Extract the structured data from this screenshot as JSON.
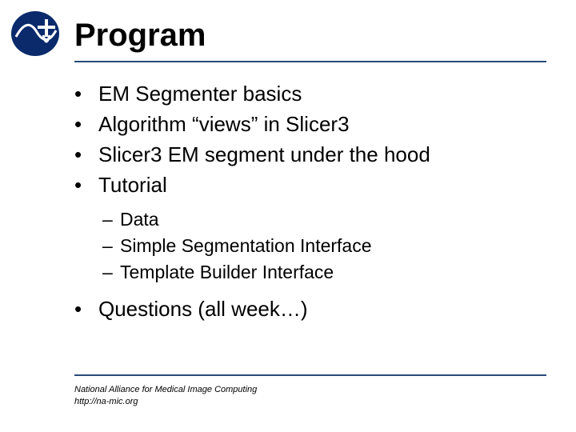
{
  "title": "Program",
  "bullets": [
    "EM Segmenter basics",
    "Algorithm “views” in Slicer3",
    "Slicer3 EM segment under the hood",
    "Tutorial"
  ],
  "sub_bullets": [
    "Data",
    "Simple Segmentation Interface",
    "Template Builder Interface"
  ],
  "last_bullet": "Questions (all week…)",
  "footer_line1": "National Alliance for Medical Image Computing",
  "footer_line2": "http://na-mic.org"
}
